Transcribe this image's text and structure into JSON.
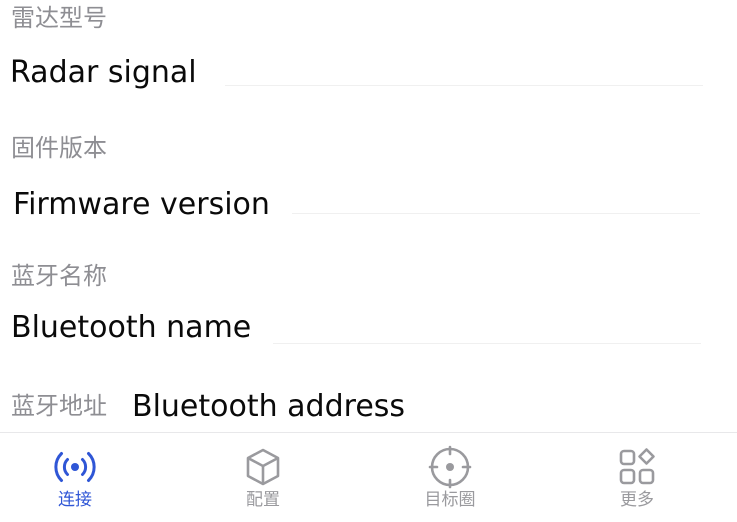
{
  "fields": [
    {
      "label": "雷达型号",
      "value": "Radar signal"
    },
    {
      "label": "固件版本",
      "value": "Firmware version"
    },
    {
      "label": "蓝牙名称",
      "value": "Bluetooth name"
    },
    {
      "label": "蓝牙地址",
      "value": "Bluetooth address"
    }
  ],
  "tabbar": {
    "active_color": "#2f56d6",
    "inactive_color": "#9a9a9e",
    "tabs": [
      {
        "label": "连接",
        "icon": "radio-signal-icon",
        "active": true
      },
      {
        "label": "配置",
        "icon": "cube-icon",
        "active": false
      },
      {
        "label": "目标圈",
        "icon": "target-icon",
        "active": false
      },
      {
        "label": "更多",
        "icon": "grid-more-icon",
        "active": false
      }
    ]
  }
}
